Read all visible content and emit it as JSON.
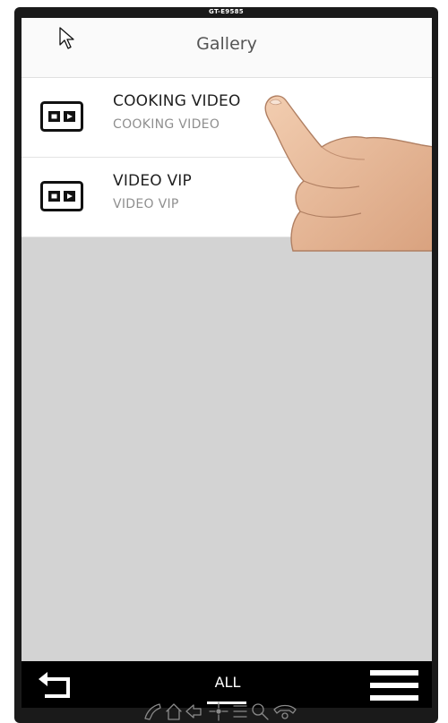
{
  "device": {
    "label": "GT-E9585"
  },
  "header": {
    "title": "Gallery"
  },
  "videos": [
    {
      "title": "COOKING VIDEO",
      "subtitle": "COOKING VIDEO"
    },
    {
      "title": "VIDEO VIP",
      "subtitle": "VIDEO VIP"
    }
  ],
  "bottom_bar": {
    "tab_label": "ALL"
  },
  "hardware_buttons": [
    "phone-icon",
    "home-icon",
    "back-arrow-icon",
    "dpad-icon",
    "menu-lines-icon",
    "search-icon",
    "hangup-icon"
  ],
  "colors": {
    "screen_bg": "#d3d3d3",
    "device_frame": "#1a1a1a",
    "bottom_bar": "#000000",
    "header_bg": "#fafafa"
  }
}
